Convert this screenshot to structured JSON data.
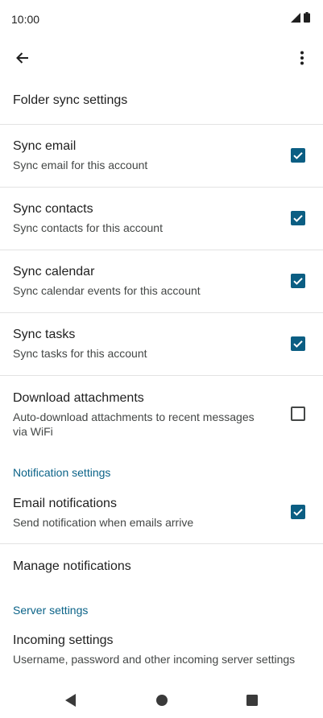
{
  "status_bar": {
    "time": "10:00"
  },
  "header": {
    "title": "Folder sync settings"
  },
  "sync_items": [
    {
      "title": "Sync email",
      "subtitle": "Sync email for this account",
      "checked": true
    },
    {
      "title": "Sync contacts",
      "subtitle": "Sync contacts for this account",
      "checked": true
    },
    {
      "title": "Sync calendar",
      "subtitle": "Sync calendar events for this account",
      "checked": true
    },
    {
      "title": "Sync tasks",
      "subtitle": "Sync tasks for this account",
      "checked": true
    },
    {
      "title": "Download attachments",
      "subtitle_line1": "Auto-download attachments to recent messages",
      "subtitle_line2": "via WiFi",
      "checked": false
    }
  ],
  "notification_section": {
    "header": "Notification settings",
    "email_notifications": {
      "title": "Email notifications",
      "subtitle": "Send notification when emails arrive",
      "checked": true
    },
    "manage": {
      "title": "Manage notifications"
    }
  },
  "server_section": {
    "header": "Server settings",
    "incoming": {
      "title": "Incoming settings",
      "subtitle": "Username, password and other incoming server settings"
    }
  },
  "colors": {
    "accent": "#0b5e83",
    "section_header": "#0b6388",
    "divider": "#e3e3e3"
  },
  "icons": {
    "back": "arrow-left",
    "more": "more-vert",
    "signal": "signal",
    "battery": "battery",
    "nav_back": "triangle",
    "nav_home": "circle",
    "nav_recents": "square"
  }
}
